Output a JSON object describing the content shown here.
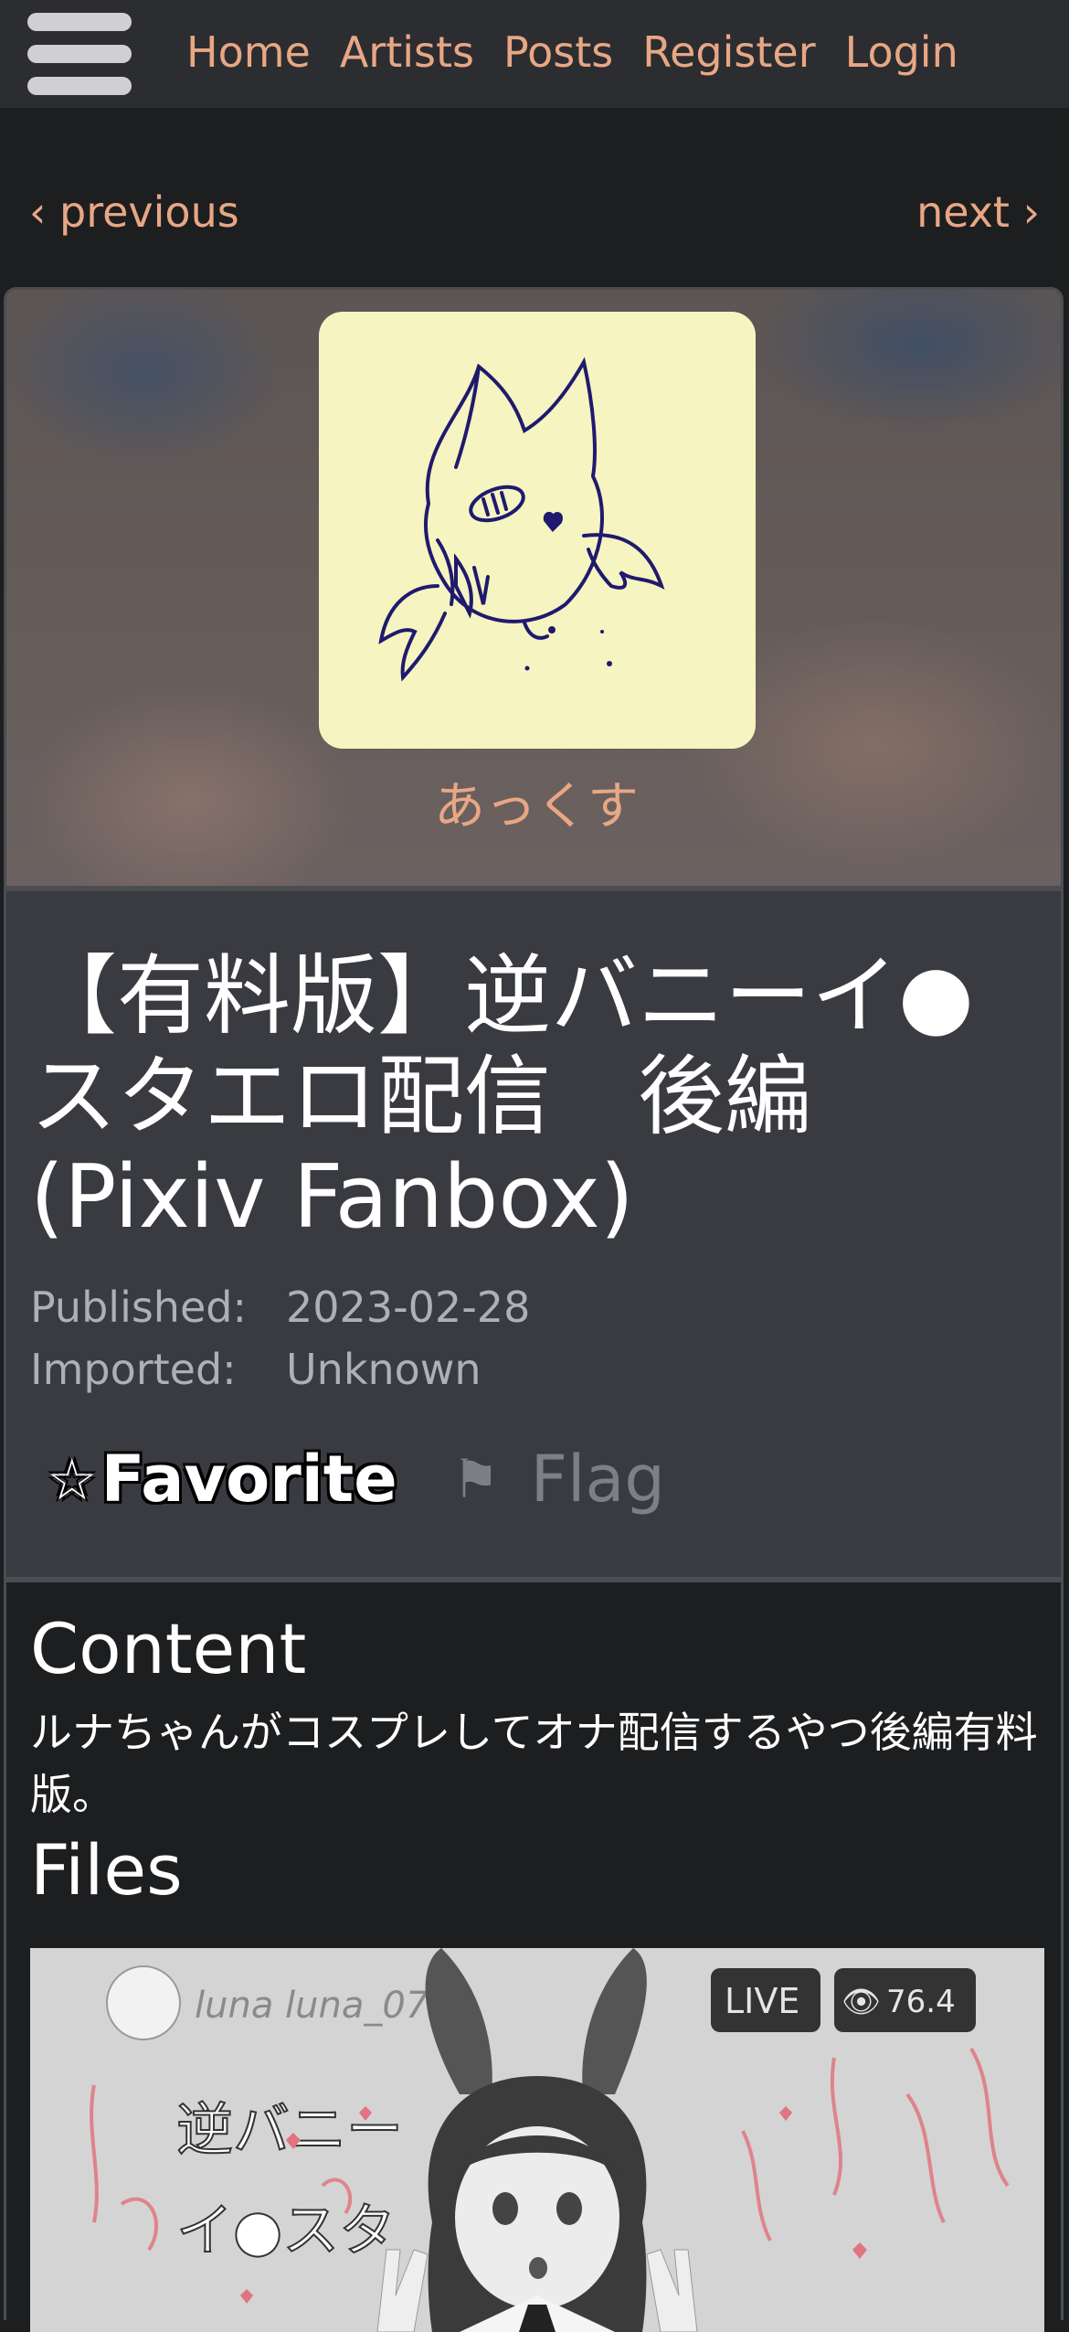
{
  "nav": {
    "menu_icon": "hamburger-menu-icon",
    "links": [
      "Home",
      "Artists",
      "Posts",
      "Register",
      "Login"
    ]
  },
  "pager": {
    "previous": "‹ previous",
    "next": "next ›"
  },
  "artist": {
    "name": "あっくす",
    "avatar_bg": "#f6f4c0"
  },
  "post": {
    "title": "【有料版】逆バニーイ●スタエロ配信　後編",
    "source": "(Pixiv Fanbox)",
    "published_label": "Published:",
    "published_value": "2023-02-28",
    "imported_label": "Imported:",
    "imported_value": "Unknown",
    "favorite_icon": "☆",
    "favorite_label": "Favorite",
    "flag_icon": "⚑",
    "flag_label": "Flag"
  },
  "content": {
    "heading": "Content",
    "text": "ルナちゃんがコスプレしてオナ配信するやつ後編有料版。",
    "files_heading": "Files"
  },
  "file_preview": {
    "username": "luna luna_072",
    "live_badge": "LIVE",
    "viewer_count": "76.4",
    "overlay_text_1": "逆バニー",
    "overlay_text_2": "イ●スタ"
  },
  "colors": {
    "accent": "#e8a784",
    "nav_bg": "#2c2d31",
    "page_bg": "#1d1e20",
    "header_bg": "#393b41"
  }
}
